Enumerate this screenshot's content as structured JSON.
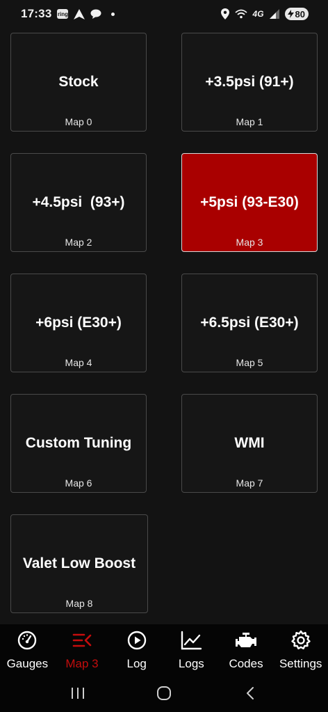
{
  "status_bar": {
    "time": "17:33",
    "ring_label": "ring",
    "network": "4G",
    "battery": "80"
  },
  "maps": [
    {
      "name": "Stock",
      "number": "Map 0"
    },
    {
      "name": "+3.5psi (91+)",
      "number": "Map 1"
    },
    {
      "name": "+4.5psi  (93+)",
      "number": "Map 2"
    },
    {
      "name": "+5psi (93-E30)",
      "number": "Map 3",
      "active": true
    },
    {
      "name": "+6psi (E30+)",
      "number": "Map 4"
    },
    {
      "name": "+6.5psi (E30+)",
      "number": "Map 5"
    },
    {
      "name": "Custom Tuning",
      "number": "Map 6"
    },
    {
      "name": "WMI",
      "number": "Map 7"
    },
    {
      "name": "Valet Low Boost",
      "number": "Map 8"
    }
  ],
  "bottom_nav": {
    "items": [
      {
        "label": "Gauges",
        "icon": "gauge-icon"
      },
      {
        "label": "Map 3",
        "icon": "map-icon",
        "active": true
      },
      {
        "label": "Log",
        "icon": "play-icon"
      },
      {
        "label": "Logs",
        "icon": "line-chart-icon"
      },
      {
        "label": "Codes",
        "icon": "engine-icon"
      },
      {
        "label": "Settings",
        "icon": "gear-icon"
      }
    ]
  },
  "colors": {
    "background": "#131313",
    "tile_border": "#4a4a4a",
    "active_tile": "#a90000",
    "active_nav": "#c40d0d"
  }
}
